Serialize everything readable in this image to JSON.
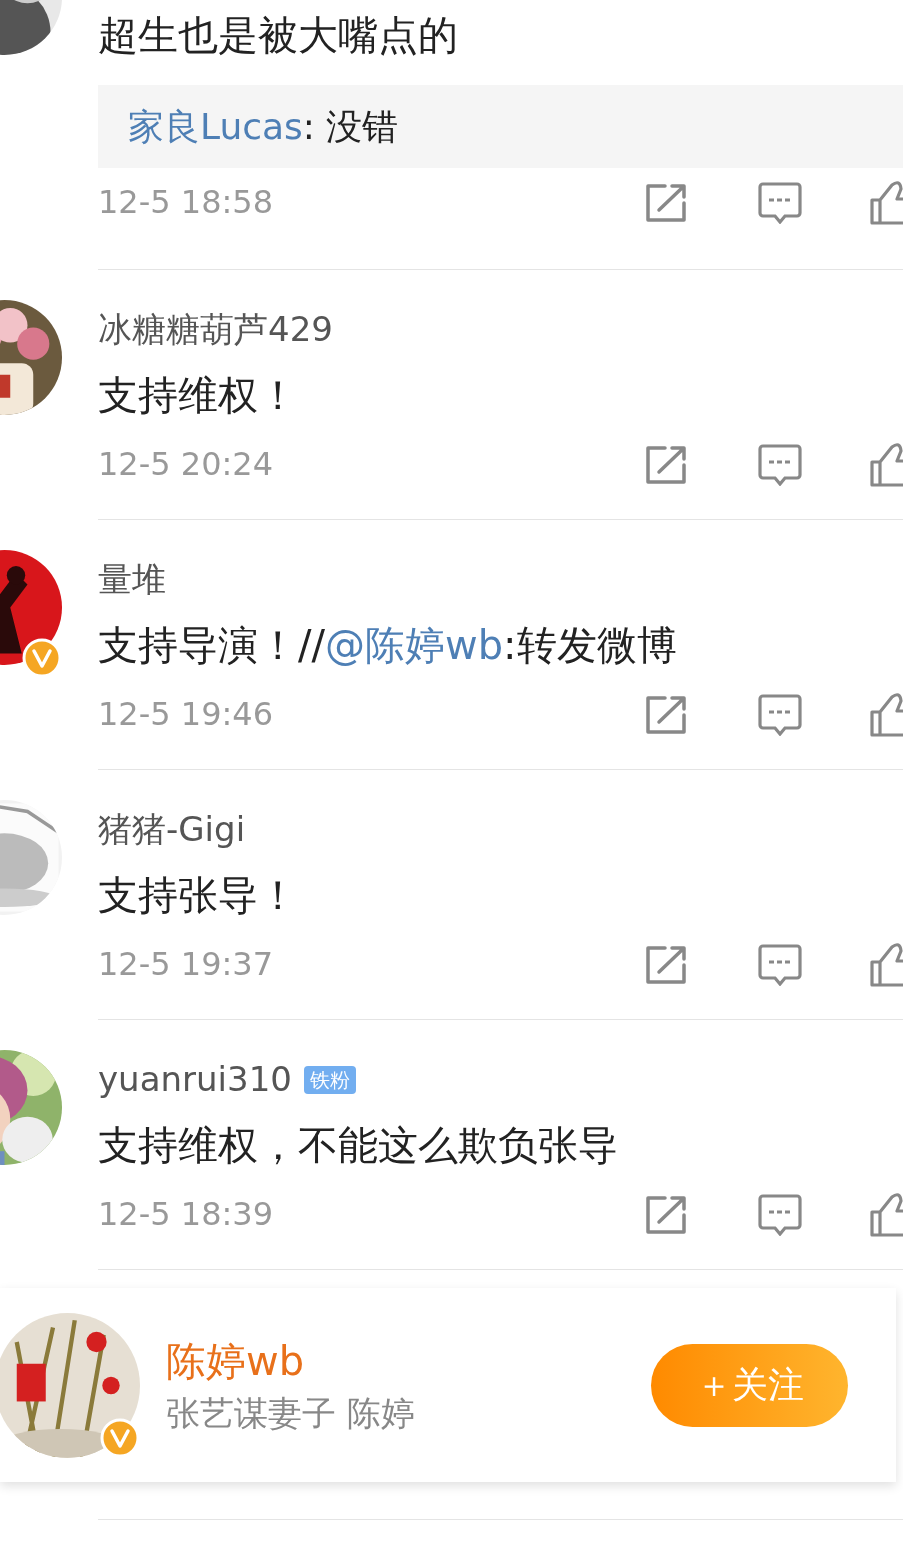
{
  "comments": [
    {
      "content": [
        {
          "kind": "plain",
          "text": "超生也是被大嘴点的"
        }
      ],
      "reply": {
        "author": "家良Lucas",
        "text": ": 没错"
      },
      "time": "12-5 18:58",
      "avatar": {
        "kind": "picture",
        "verified": false
      }
    },
    {
      "user": "冰糖糖葫芦429",
      "content": [
        {
          "kind": "plain",
          "text": "支持维权！"
        }
      ],
      "time": "12-5 20:24",
      "avatar": {
        "kind": "picture",
        "verified": false
      }
    },
    {
      "user": "量堆",
      "content": [
        {
          "kind": "plain",
          "text": "支持导演！//"
        },
        {
          "kind": "mention",
          "text": "@陈婷wb"
        },
        {
          "kind": "plain",
          "text": ":转发微博"
        }
      ],
      "time": "12-5 19:46",
      "avatar": {
        "kind": "picture",
        "verified": true
      }
    },
    {
      "user": "猪猪-Gigi",
      "content": [
        {
          "kind": "plain",
          "text": "支持张导！"
        }
      ],
      "time": "12-5 19:37",
      "avatar": {
        "kind": "picture",
        "verified": false
      }
    },
    {
      "user": "yuanrui310",
      "badge": "铁粉",
      "content": [
        {
          "kind": "plain",
          "text": "支持维权，不能这么欺负张导"
        }
      ],
      "time": "12-5 18:39",
      "avatar": {
        "kind": "picture",
        "verified": false
      }
    }
  ],
  "follow_card": {
    "name": "陈婷wb",
    "description": "张艺谋妻子 陈婷",
    "button": "＋关注",
    "avatar": {
      "kind": "picture",
      "verified": true
    }
  }
}
